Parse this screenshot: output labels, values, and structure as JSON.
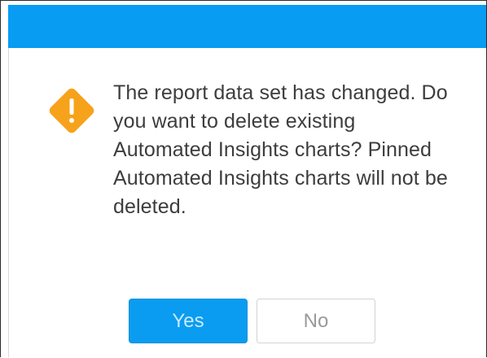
{
  "dialog": {
    "message": "The report data set has changed. Do you want to delete existing Automated Insights charts? Pinned Automated Insights charts will not be deleted.",
    "icon": "warning-icon",
    "buttons": {
      "yes_label": "Yes",
      "no_label": "No"
    }
  },
  "colors": {
    "titlebar": "#089cf3",
    "warning": "#f7a21b",
    "primary_button": "#099cf1"
  }
}
